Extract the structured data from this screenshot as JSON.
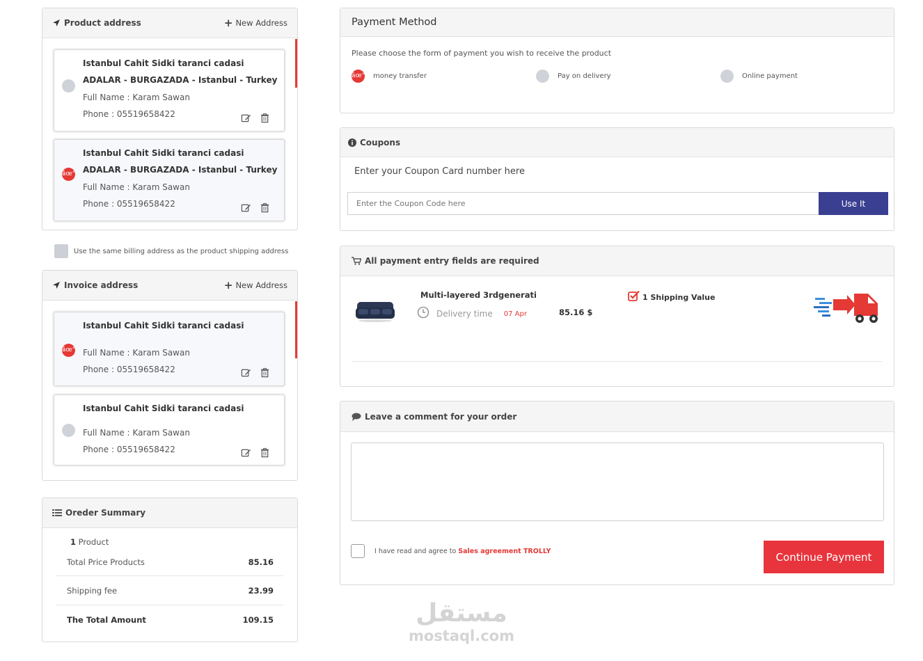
{
  "product_address": {
    "title": "Product address",
    "new_address_label": "New Address",
    "cards": [
      {
        "line1": "Istanbul Cahit Sidki taranci cadasi",
        "line2": "ADALAR - BURGAZADA - Istanbul - Turkey",
        "full_name": "Full Name : Karam Sawan",
        "phone": "Phone : 05519658422",
        "selected": false
      },
      {
        "line1": "Istanbul Cahit Sidki taranci cadasi",
        "line2": "ADALAR - BURGAZADA - Istanbul - Turkey",
        "full_name": "Full Name : Karam Sawan",
        "phone": "Phone : 05519658422",
        "selected": true,
        "radio_glyph": "âœ“"
      }
    ]
  },
  "same_billing_label": "Use the same billing address as the product shipping address",
  "invoice_address": {
    "title": "Invoice address",
    "new_address_label": "New Address",
    "cards": [
      {
        "line1": "Istanbul Cahit Sidki taranci cadasi",
        "full_name": "Full Name : Karam Sawan",
        "phone": "Phone : 05519658422",
        "selected": true,
        "radio_glyph": "âœ“"
      },
      {
        "line1": "Istanbul Cahit Sidki taranci cadasi",
        "full_name": "Full Name : Karam Sawan",
        "phone": "Phone : 05519658422",
        "selected": false
      }
    ]
  },
  "order_summary": {
    "title": "Oreder Summary",
    "product_count": "1",
    "product_label": "Product",
    "rows": [
      {
        "label": "Total Price Products",
        "value": "85.16"
      },
      {
        "label": "Shipping fee",
        "value": "23.99"
      },
      {
        "label": "The Total Amount",
        "value": "109.15"
      }
    ]
  },
  "payment_method": {
    "title": "Payment Method",
    "prompt": "Please choose the form of payment you wish to receive the product",
    "options": [
      {
        "label": "money transfer",
        "selected": true,
        "radio_glyph": "âœ“"
      },
      {
        "label": "Pay on delivery",
        "selected": false
      },
      {
        "label": "Online payment",
        "selected": false
      }
    ]
  },
  "coupons": {
    "title": "Coupons",
    "prompt": "Enter your Coupon Card number here",
    "placeholder": "Enter the Coupon Code here",
    "button_label": "Use It"
  },
  "entry_fields": {
    "title": "All payment entry fields are required",
    "product_name": "Multi-layered 3rdgenerati",
    "delivery_label": "Delivery time",
    "delivery_date": "07 Apr",
    "price": "85.16 $",
    "shipping_value": "1 Shipping Value"
  },
  "comment": {
    "title": "Leave a comment for your order",
    "agree_prefix": "I have read and agree to",
    "agree_link": "Sales agreement TROLLY",
    "continue_label": "Continue Payment"
  },
  "watermark": {
    "arabic": "مستقل",
    "latin": "mostaql.com"
  },
  "colors": {
    "accent_red": "#e8343c",
    "button_blue": "#3a3f91",
    "radio_grey": "#cfd3d9"
  }
}
